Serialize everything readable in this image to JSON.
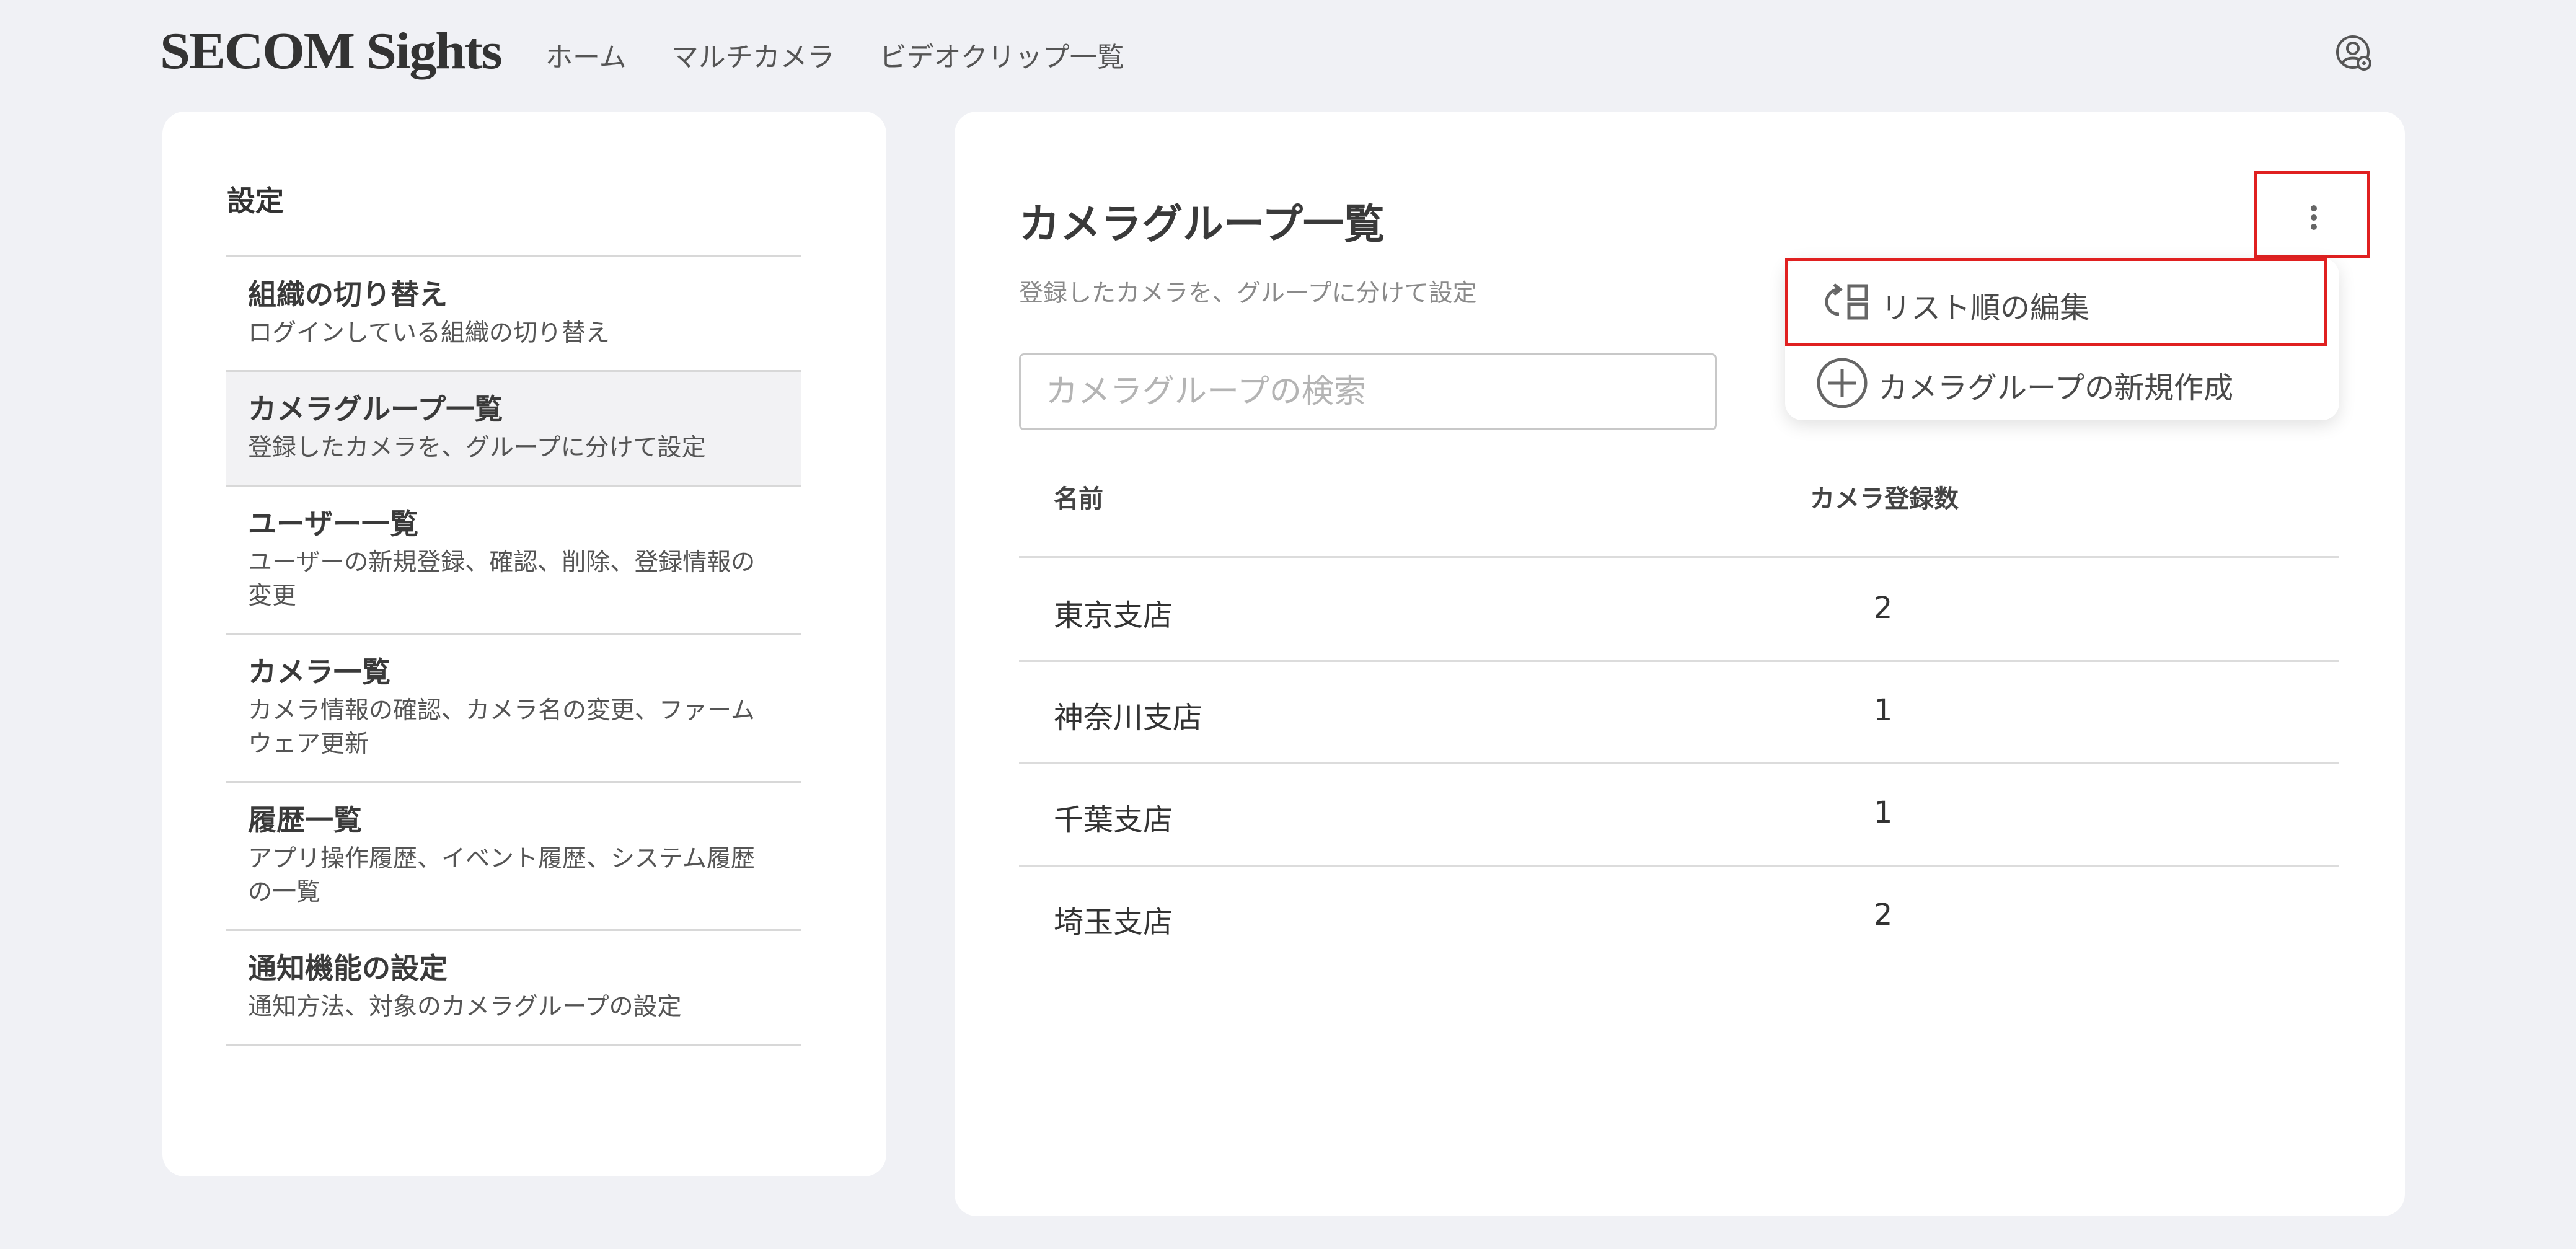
{
  "header": {
    "logo": "SECOM Sights",
    "nav": [
      "ホーム",
      "マルチカメラ",
      "ビデオクリップ一覧"
    ],
    "account_icon": "account-settings-icon"
  },
  "sidebar": {
    "title": "設定",
    "items": [
      {
        "title": "組織の切り替え",
        "desc": "ログインしている組織の切り替え",
        "active": false
      },
      {
        "title": "カメラグループ一覧",
        "desc": "登録したカメラを、グループに分けて設定",
        "active": true
      },
      {
        "title": "ユーザー一覧",
        "desc": "ユーザーの新規登録、確認、削除、登録情報の変更",
        "active": false
      },
      {
        "title": "カメラ一覧",
        "desc": "カメラ情報の確認、カメラ名の変更、ファームウェア更新",
        "active": false
      },
      {
        "title": "履歴一覧",
        "desc": "アプリ操作履歴、イベント履歴、システム履歴の一覧",
        "active": false
      },
      {
        "title": "通知機能の設定",
        "desc": "通知方法、対象のカメラグループの設定",
        "active": false
      }
    ]
  },
  "main": {
    "title": "カメラグループ一覧",
    "subtitle": "登録したカメラを、グループに分けて設定",
    "search_placeholder": "カメラグループの検索",
    "menu": {
      "items": [
        {
          "label": "リスト順の編集",
          "icon": "reorder-list-icon"
        },
        {
          "label": "カメラグループの新規作成",
          "icon": "add-circle-icon"
        }
      ]
    },
    "table": {
      "columns": [
        "名前",
        "カメラ登録数"
      ],
      "rows": [
        {
          "name": "東京支店",
          "count": "2"
        },
        {
          "name": "神奈川支店",
          "count": "1"
        },
        {
          "name": "千葉支店",
          "count": "1"
        },
        {
          "name": "埼玉支店",
          "count": "2"
        }
      ]
    }
  },
  "colors": {
    "background": "#f0f1f5",
    "highlight": "#e02020",
    "active_item": "#f2f2f4"
  }
}
